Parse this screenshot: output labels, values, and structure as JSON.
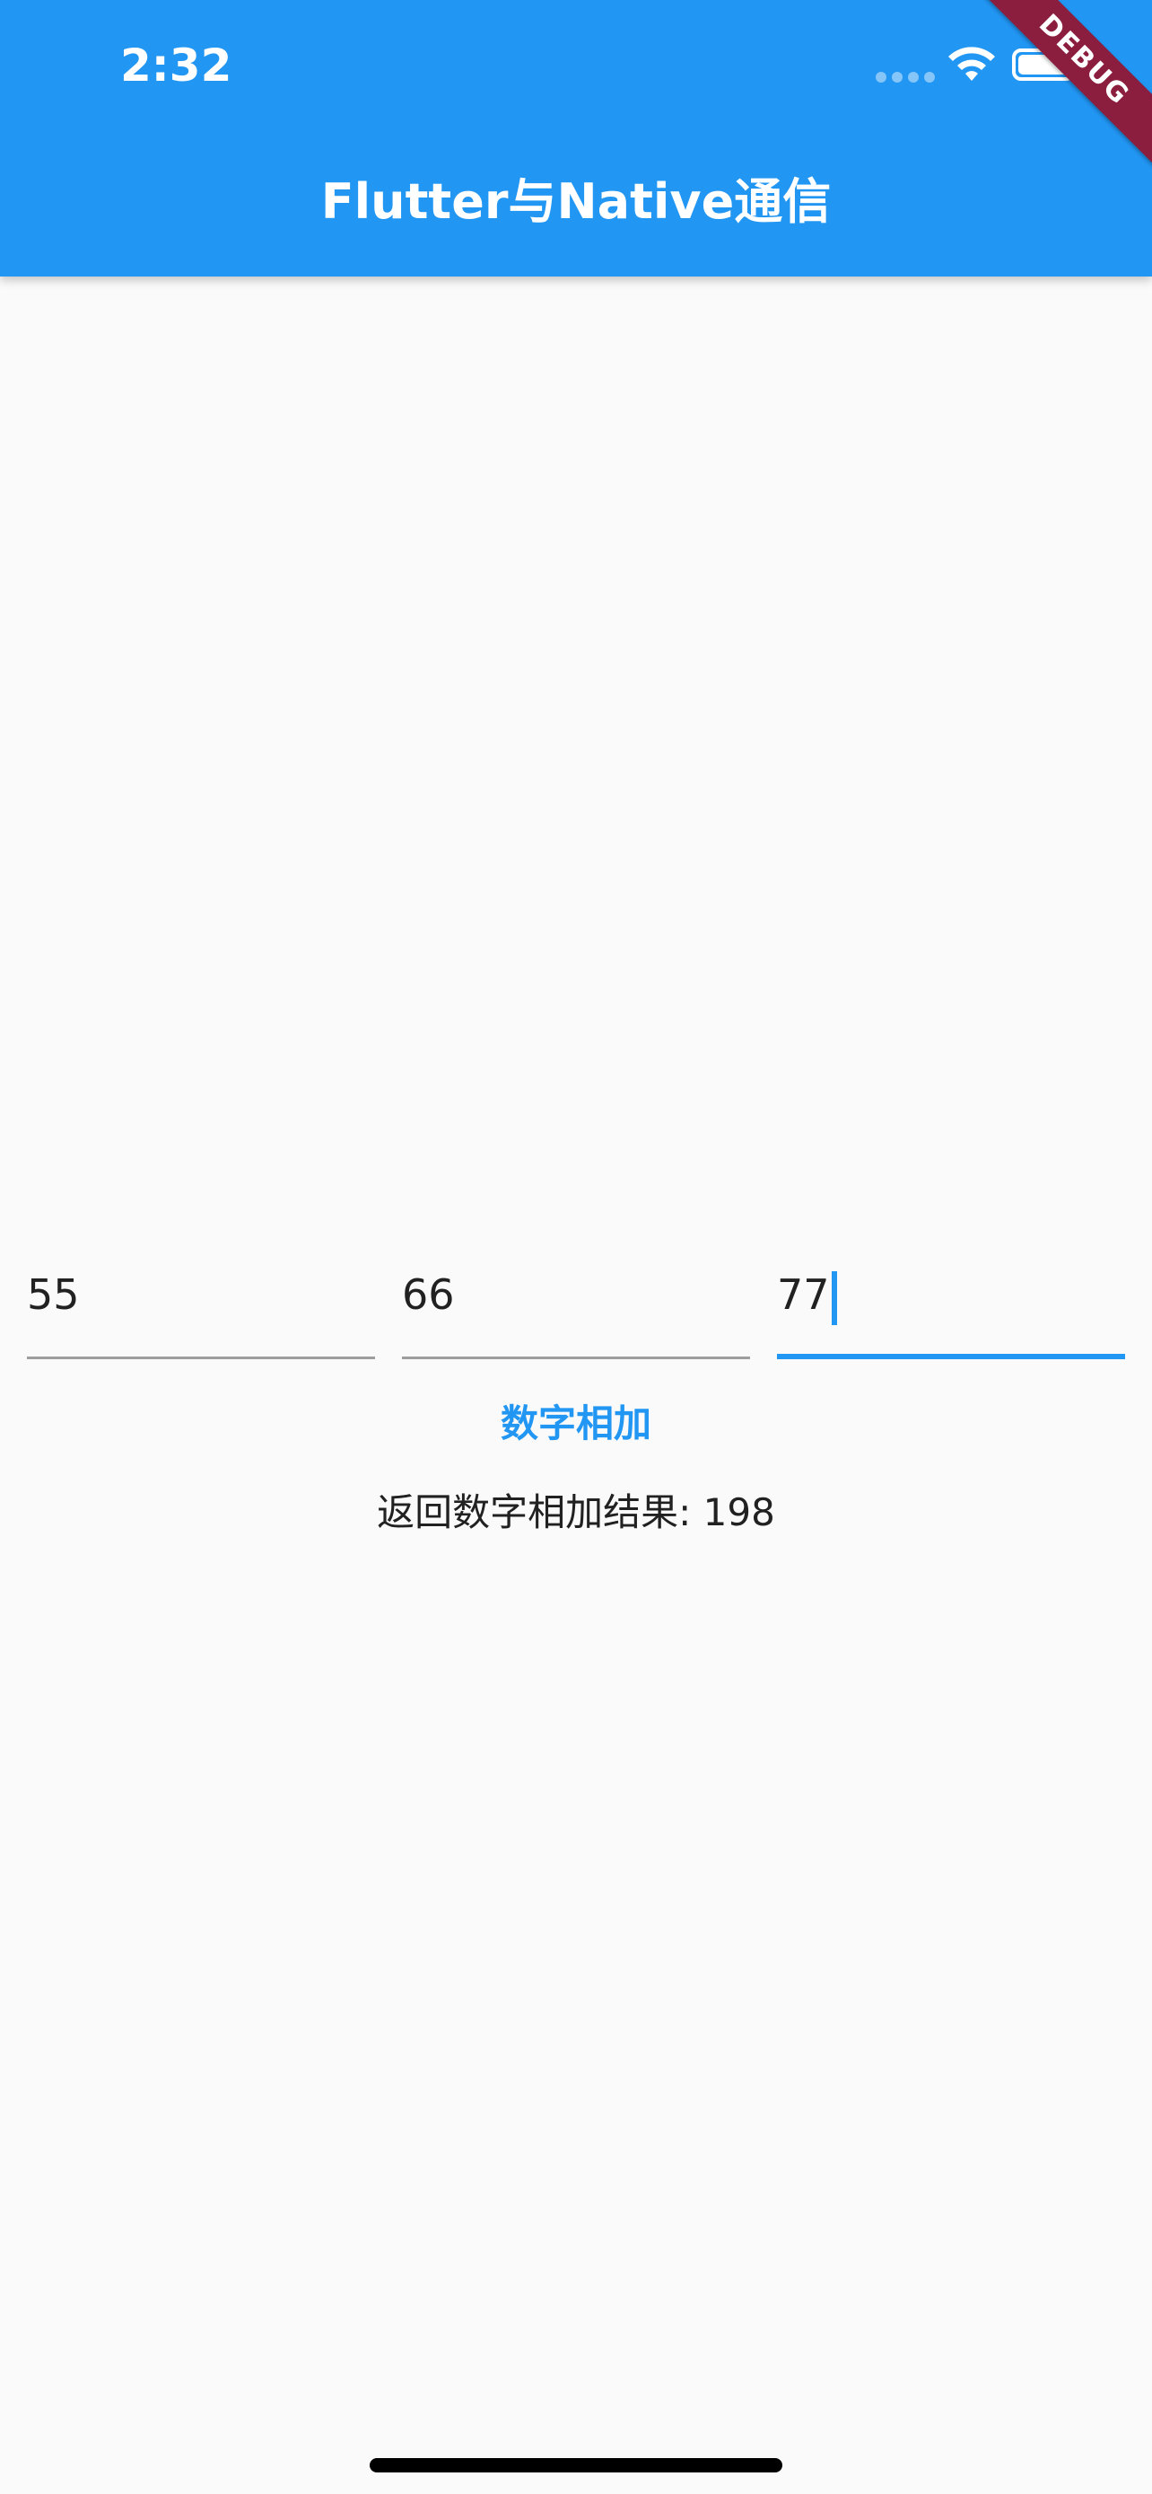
{
  "status_bar": {
    "time": "2:32",
    "icons": [
      "cellular-signal-icon",
      "wifi-icon",
      "battery-icon"
    ]
  },
  "debug_banner": "DEBUG",
  "app_bar": {
    "title": "Flutter与Native通信",
    "background_color": "#2196f3"
  },
  "inputs": [
    {
      "value": "55",
      "focused": false
    },
    {
      "value": "66",
      "focused": false
    },
    {
      "value": "77",
      "focused": true
    }
  ],
  "action": {
    "button_label": "数字相加",
    "accent_color": "#2196f3"
  },
  "result": {
    "text": "返回数字相加结果: 198"
  }
}
